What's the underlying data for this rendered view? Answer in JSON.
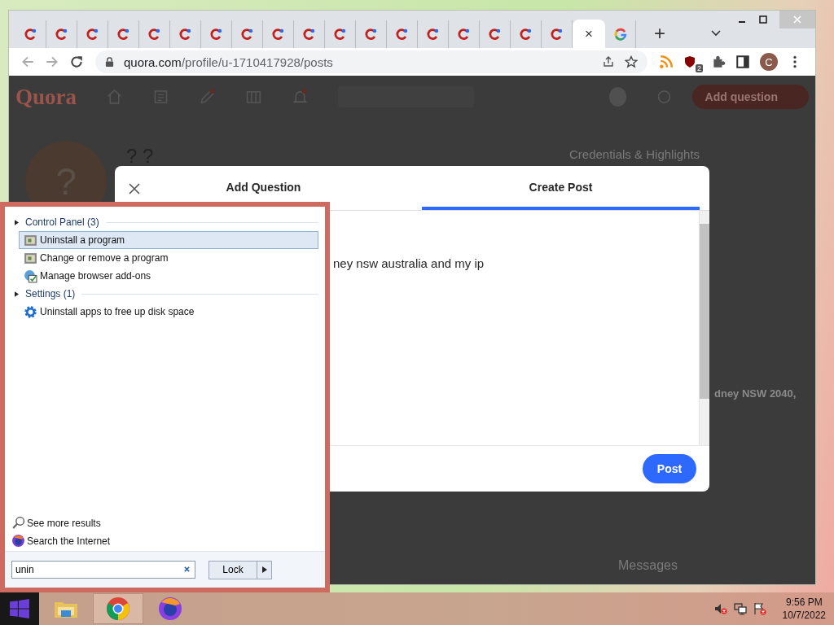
{
  "browser": {
    "tabs": [
      {
        "kind": "quora",
        "selected": false
      },
      {
        "kind": "quora",
        "selected": false
      },
      {
        "kind": "quora",
        "selected": false
      },
      {
        "kind": "quora",
        "selected": false
      },
      {
        "kind": "quora",
        "selected": false
      },
      {
        "kind": "quora",
        "selected": false
      },
      {
        "kind": "quora",
        "selected": false
      },
      {
        "kind": "quora",
        "selected": false
      },
      {
        "kind": "quora",
        "selected": false
      },
      {
        "kind": "quora",
        "selected": false
      },
      {
        "kind": "quora",
        "selected": false
      },
      {
        "kind": "quora",
        "selected": false
      },
      {
        "kind": "quora",
        "selected": false
      },
      {
        "kind": "quora",
        "selected": false
      },
      {
        "kind": "quora",
        "selected": false
      },
      {
        "kind": "quora",
        "selected": false
      },
      {
        "kind": "quora",
        "selected": false
      },
      {
        "kind": "quora",
        "selected": false
      },
      {
        "kind": "blank",
        "selected": true,
        "close": "×"
      },
      {
        "kind": "google",
        "selected": false
      }
    ],
    "new_tab": "+",
    "address": {
      "host": "quora.com",
      "path": "/profile/u-1710417928/posts"
    },
    "extension_badge": "2",
    "profile_initial": "C"
  },
  "quora": {
    "logo": "Quora",
    "add_question": "Add question",
    "avatar": "?",
    "name": "? ?",
    "credentials_heading": "Credentials & Highlights",
    "location": "dney NSW 2040,",
    "messages": "Messages"
  },
  "modal": {
    "tabs": [
      {
        "label": "Add Question",
        "selected": false
      },
      {
        "label": "Create Post",
        "selected": true
      }
    ],
    "body_text": "ney nsw australia and my ip",
    "post_button": "Post"
  },
  "start_menu": {
    "groups": [
      {
        "title": "Control Panel (3)",
        "items": [
          {
            "label": "Uninstall a program",
            "kind": "program",
            "selected": true
          },
          {
            "label": "Change or remove a program",
            "kind": "program",
            "selected": false
          },
          {
            "label": "Manage browser add-ons",
            "kind": "addons",
            "selected": false
          }
        ]
      },
      {
        "title": "Settings (1)",
        "items": [
          {
            "label": "Uninstall apps to free up disk space",
            "kind": "gear",
            "selected": false
          }
        ]
      }
    ],
    "links": [
      {
        "label": "See more results",
        "kind": "search"
      },
      {
        "label": "Search the Internet",
        "kind": "firefox"
      }
    ],
    "search_value": "unin",
    "power_button": "Lock"
  },
  "taskbar": {
    "apps": [
      {
        "kind": "explorer",
        "selected": false
      },
      {
        "kind": "chrome",
        "selected": true
      },
      {
        "kind": "firefox",
        "selected": false
      }
    ],
    "time": "9:56 PM",
    "date": "10/7/2022"
  }
}
